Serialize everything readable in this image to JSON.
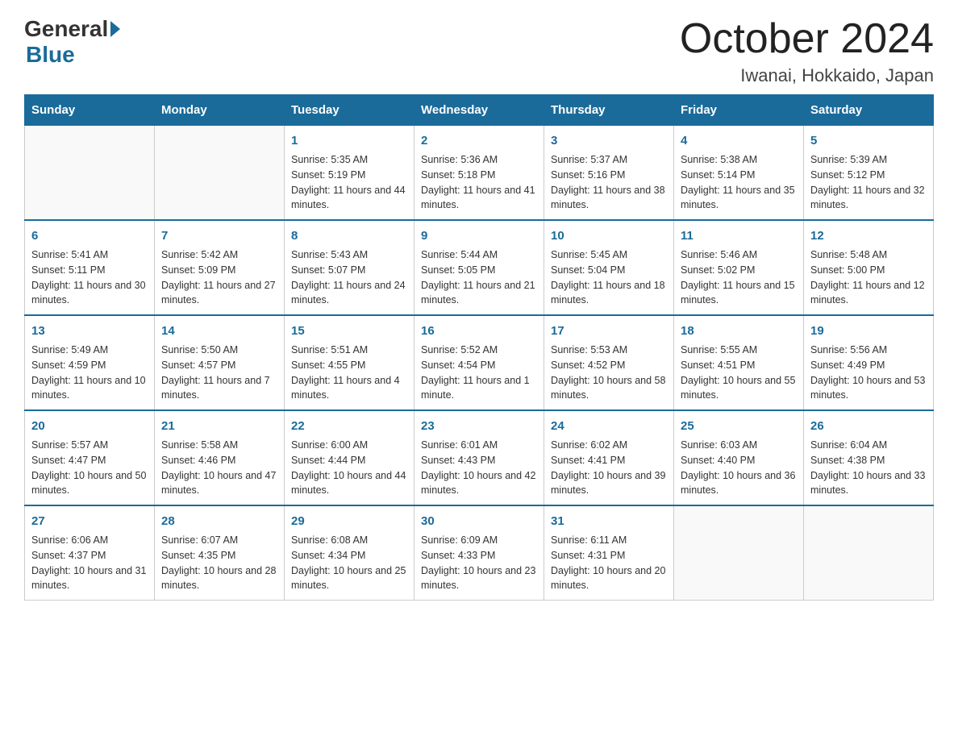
{
  "header": {
    "logo_general": "General",
    "logo_blue": "Blue",
    "month_title": "October 2024",
    "location": "Iwanai, Hokkaido, Japan"
  },
  "weekdays": [
    "Sunday",
    "Monday",
    "Tuesday",
    "Wednesday",
    "Thursday",
    "Friday",
    "Saturday"
  ],
  "weeks": [
    [
      {
        "day": "",
        "sunrise": "",
        "sunset": "",
        "daylight": ""
      },
      {
        "day": "",
        "sunrise": "",
        "sunset": "",
        "daylight": ""
      },
      {
        "day": "1",
        "sunrise": "Sunrise: 5:35 AM",
        "sunset": "Sunset: 5:19 PM",
        "daylight": "Daylight: 11 hours and 44 minutes."
      },
      {
        "day": "2",
        "sunrise": "Sunrise: 5:36 AM",
        "sunset": "Sunset: 5:18 PM",
        "daylight": "Daylight: 11 hours and 41 minutes."
      },
      {
        "day": "3",
        "sunrise": "Sunrise: 5:37 AM",
        "sunset": "Sunset: 5:16 PM",
        "daylight": "Daylight: 11 hours and 38 minutes."
      },
      {
        "day": "4",
        "sunrise": "Sunrise: 5:38 AM",
        "sunset": "Sunset: 5:14 PM",
        "daylight": "Daylight: 11 hours and 35 minutes."
      },
      {
        "day": "5",
        "sunrise": "Sunrise: 5:39 AM",
        "sunset": "Sunset: 5:12 PM",
        "daylight": "Daylight: 11 hours and 32 minutes."
      }
    ],
    [
      {
        "day": "6",
        "sunrise": "Sunrise: 5:41 AM",
        "sunset": "Sunset: 5:11 PM",
        "daylight": "Daylight: 11 hours and 30 minutes."
      },
      {
        "day": "7",
        "sunrise": "Sunrise: 5:42 AM",
        "sunset": "Sunset: 5:09 PM",
        "daylight": "Daylight: 11 hours and 27 minutes."
      },
      {
        "day": "8",
        "sunrise": "Sunrise: 5:43 AM",
        "sunset": "Sunset: 5:07 PM",
        "daylight": "Daylight: 11 hours and 24 minutes."
      },
      {
        "day": "9",
        "sunrise": "Sunrise: 5:44 AM",
        "sunset": "Sunset: 5:05 PM",
        "daylight": "Daylight: 11 hours and 21 minutes."
      },
      {
        "day": "10",
        "sunrise": "Sunrise: 5:45 AM",
        "sunset": "Sunset: 5:04 PM",
        "daylight": "Daylight: 11 hours and 18 minutes."
      },
      {
        "day": "11",
        "sunrise": "Sunrise: 5:46 AM",
        "sunset": "Sunset: 5:02 PM",
        "daylight": "Daylight: 11 hours and 15 minutes."
      },
      {
        "day": "12",
        "sunrise": "Sunrise: 5:48 AM",
        "sunset": "Sunset: 5:00 PM",
        "daylight": "Daylight: 11 hours and 12 minutes."
      }
    ],
    [
      {
        "day": "13",
        "sunrise": "Sunrise: 5:49 AM",
        "sunset": "Sunset: 4:59 PM",
        "daylight": "Daylight: 11 hours and 10 minutes."
      },
      {
        "day": "14",
        "sunrise": "Sunrise: 5:50 AM",
        "sunset": "Sunset: 4:57 PM",
        "daylight": "Daylight: 11 hours and 7 minutes."
      },
      {
        "day": "15",
        "sunrise": "Sunrise: 5:51 AM",
        "sunset": "Sunset: 4:55 PM",
        "daylight": "Daylight: 11 hours and 4 minutes."
      },
      {
        "day": "16",
        "sunrise": "Sunrise: 5:52 AM",
        "sunset": "Sunset: 4:54 PM",
        "daylight": "Daylight: 11 hours and 1 minute."
      },
      {
        "day": "17",
        "sunrise": "Sunrise: 5:53 AM",
        "sunset": "Sunset: 4:52 PM",
        "daylight": "Daylight: 10 hours and 58 minutes."
      },
      {
        "day": "18",
        "sunrise": "Sunrise: 5:55 AM",
        "sunset": "Sunset: 4:51 PM",
        "daylight": "Daylight: 10 hours and 55 minutes."
      },
      {
        "day": "19",
        "sunrise": "Sunrise: 5:56 AM",
        "sunset": "Sunset: 4:49 PM",
        "daylight": "Daylight: 10 hours and 53 minutes."
      }
    ],
    [
      {
        "day": "20",
        "sunrise": "Sunrise: 5:57 AM",
        "sunset": "Sunset: 4:47 PM",
        "daylight": "Daylight: 10 hours and 50 minutes."
      },
      {
        "day": "21",
        "sunrise": "Sunrise: 5:58 AM",
        "sunset": "Sunset: 4:46 PM",
        "daylight": "Daylight: 10 hours and 47 minutes."
      },
      {
        "day": "22",
        "sunrise": "Sunrise: 6:00 AM",
        "sunset": "Sunset: 4:44 PM",
        "daylight": "Daylight: 10 hours and 44 minutes."
      },
      {
        "day": "23",
        "sunrise": "Sunrise: 6:01 AM",
        "sunset": "Sunset: 4:43 PM",
        "daylight": "Daylight: 10 hours and 42 minutes."
      },
      {
        "day": "24",
        "sunrise": "Sunrise: 6:02 AM",
        "sunset": "Sunset: 4:41 PM",
        "daylight": "Daylight: 10 hours and 39 minutes."
      },
      {
        "day": "25",
        "sunrise": "Sunrise: 6:03 AM",
        "sunset": "Sunset: 4:40 PM",
        "daylight": "Daylight: 10 hours and 36 minutes."
      },
      {
        "day": "26",
        "sunrise": "Sunrise: 6:04 AM",
        "sunset": "Sunset: 4:38 PM",
        "daylight": "Daylight: 10 hours and 33 minutes."
      }
    ],
    [
      {
        "day": "27",
        "sunrise": "Sunrise: 6:06 AM",
        "sunset": "Sunset: 4:37 PM",
        "daylight": "Daylight: 10 hours and 31 minutes."
      },
      {
        "day": "28",
        "sunrise": "Sunrise: 6:07 AM",
        "sunset": "Sunset: 4:35 PM",
        "daylight": "Daylight: 10 hours and 28 minutes."
      },
      {
        "day": "29",
        "sunrise": "Sunrise: 6:08 AM",
        "sunset": "Sunset: 4:34 PM",
        "daylight": "Daylight: 10 hours and 25 minutes."
      },
      {
        "day": "30",
        "sunrise": "Sunrise: 6:09 AM",
        "sunset": "Sunset: 4:33 PM",
        "daylight": "Daylight: 10 hours and 23 minutes."
      },
      {
        "day": "31",
        "sunrise": "Sunrise: 6:11 AM",
        "sunset": "Sunset: 4:31 PM",
        "daylight": "Daylight: 10 hours and 20 minutes."
      },
      {
        "day": "",
        "sunrise": "",
        "sunset": "",
        "daylight": ""
      },
      {
        "day": "",
        "sunrise": "",
        "sunset": "",
        "daylight": ""
      }
    ]
  ]
}
